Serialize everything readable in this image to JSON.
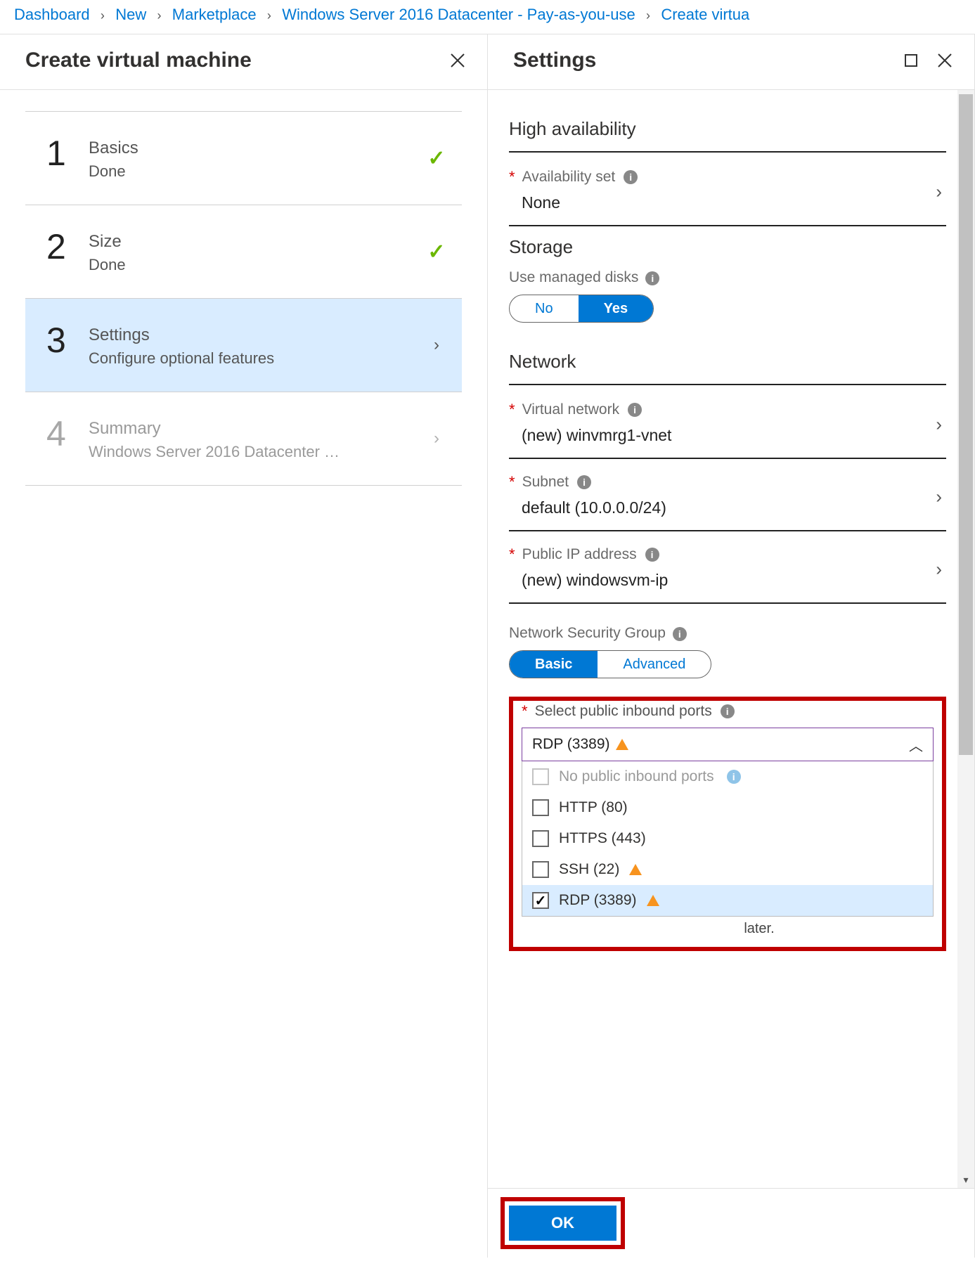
{
  "breadcrumb": {
    "items": [
      "Dashboard",
      "New",
      "Marketplace",
      "Windows Server 2016 Datacenter - Pay-as-you-use",
      "Create virtua"
    ]
  },
  "leftPane": {
    "title": "Create virtual machine",
    "steps": [
      {
        "num": "1",
        "title": "Basics",
        "sub": "Done",
        "state": "done"
      },
      {
        "num": "2",
        "title": "Size",
        "sub": "Done",
        "state": "done"
      },
      {
        "num": "3",
        "title": "Settings",
        "sub": "Configure optional features",
        "state": "active"
      },
      {
        "num": "4",
        "title": "Summary",
        "sub": "Windows Server 2016 Datacenter …",
        "state": "disabled"
      }
    ]
  },
  "rightPane": {
    "title": "Settings",
    "sections": {
      "ha": {
        "heading": "High availability",
        "availSet": {
          "label": "Availability set",
          "value": "None"
        }
      },
      "storage": {
        "heading": "Storage",
        "managed": {
          "label": "Use managed disks",
          "no": "No",
          "yes": "Yes"
        }
      },
      "network": {
        "heading": "Network",
        "vnet": {
          "label": "Virtual network",
          "value": "(new) winvmrg1-vnet"
        },
        "subnet": {
          "label": "Subnet",
          "value": "default (10.0.0.0/24)"
        },
        "pip": {
          "label": "Public IP address",
          "value": "(new) windowsvm-ip"
        },
        "nsg": {
          "label": "Network Security Group",
          "basic": "Basic",
          "adv": "Advanced"
        },
        "ports": {
          "label": "Select public inbound ports",
          "selected": "RDP (3389)",
          "options": [
            {
              "label": "No public inbound ports",
              "disabled": true,
              "info": true
            },
            {
              "label": "HTTP (80)"
            },
            {
              "label": "HTTPS (443)"
            },
            {
              "label": "SSH (22)",
              "warn": true
            },
            {
              "label": "RDP (3389)",
              "warn": true,
              "checked": true
            }
          ],
          "later": "later."
        }
      }
    },
    "ok": "OK"
  }
}
